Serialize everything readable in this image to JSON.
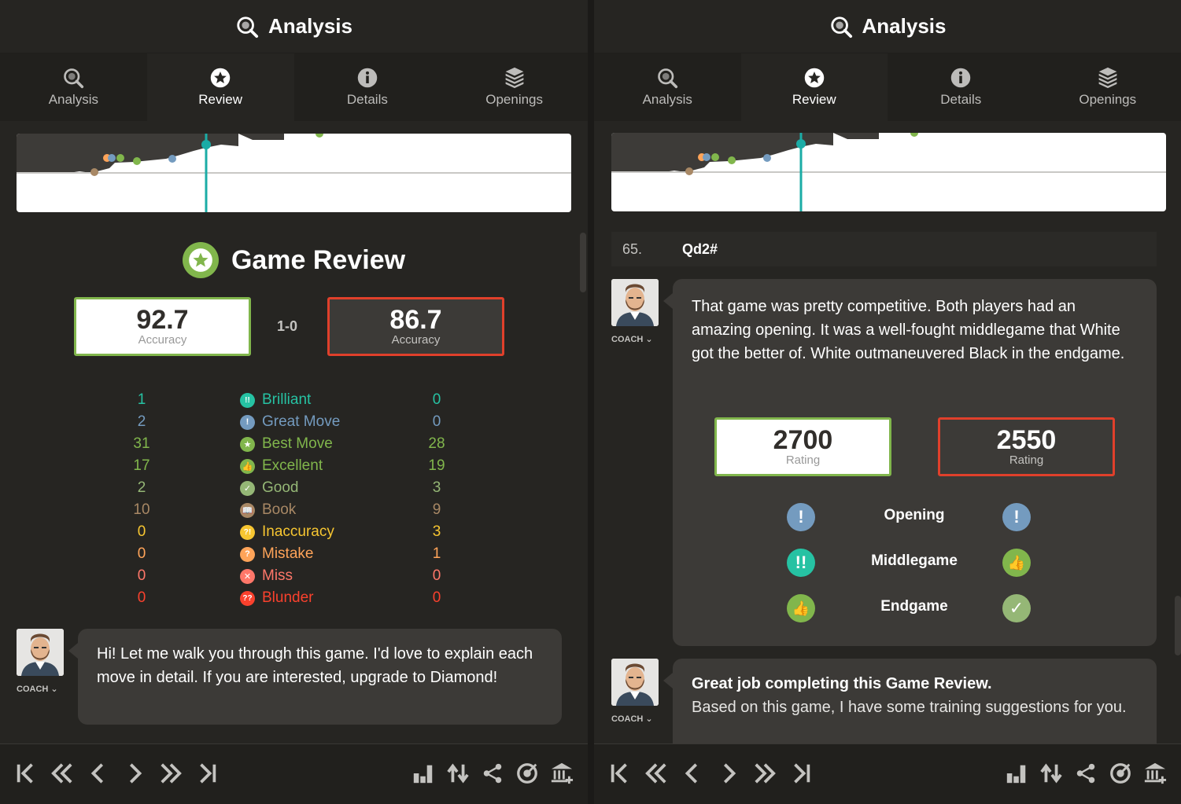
{
  "left": {
    "header_title": "Analysis",
    "tabs": [
      {
        "label": "Analysis",
        "icon": "magnifier-icon"
      },
      {
        "label": "Review",
        "icon": "star-icon"
      },
      {
        "label": "Details",
        "icon": "info-icon"
      },
      {
        "label": "Openings",
        "icon": "book-stack-icon"
      }
    ],
    "active_tab": "Review",
    "review_title": "Game Review",
    "white_accuracy": "92.7",
    "black_accuracy": "86.7",
    "accuracy_label": "Accuracy",
    "result": "1-0",
    "stats": [
      {
        "label": "Brilliant",
        "white": "1",
        "black": "0",
        "color": "#26c2a3",
        "icon": "!!"
      },
      {
        "label": "Great Move",
        "white": "2",
        "black": "0",
        "color": "#749bbf",
        "icon": "!"
      },
      {
        "label": "Best Move",
        "white": "31",
        "black": "28",
        "color": "#81b64c",
        "icon": "★"
      },
      {
        "label": "Excellent",
        "white": "17",
        "black": "19",
        "color": "#81b64c",
        "icon": "👍"
      },
      {
        "label": "Good",
        "white": "2",
        "black": "3",
        "color": "#95b776",
        "icon": "✓"
      },
      {
        "label": "Book",
        "white": "10",
        "black": "9",
        "color": "#a88865",
        "icon": "📖"
      },
      {
        "label": "Inaccuracy",
        "white": "0",
        "black": "3",
        "color": "#f7c631",
        "icon": "?!"
      },
      {
        "label": "Mistake",
        "white": "0",
        "black": "1",
        "color": "#ffa459",
        "icon": "?"
      },
      {
        "label": "Miss",
        "white": "0",
        "black": "0",
        "color": "#ff7769",
        "icon": "✕"
      },
      {
        "label": "Blunder",
        "white": "0",
        "black": "0",
        "color": "#fa412d",
        "icon": "??"
      }
    ],
    "coach_label": "COACH",
    "coach_message": "Hi! Let me walk you through this game. I'd love to explain each move in detail. If you are interested, upgrade to Diamond!"
  },
  "right": {
    "header_title": "Analysis",
    "tabs": [
      {
        "label": "Analysis"
      },
      {
        "label": "Review"
      },
      {
        "label": "Details"
      },
      {
        "label": "Openings"
      }
    ],
    "move_number": "65.",
    "move": "Qd2#",
    "coach_label": "COACH",
    "coach_message": "That game was pretty competitive. Both players had an amazing opening. It was a well-fought middlegame that White got the better of. White outmaneuvered Black in the endgame.",
    "white_rating": "2700",
    "black_rating": "2550",
    "rating_label": "Rating",
    "phases": [
      {
        "label": "Opening",
        "white_icon": "great-move-icon",
        "black_icon": "great-move-icon"
      },
      {
        "label": "Middlegame",
        "white_icon": "brilliant-icon",
        "black_icon": "excellent-icon"
      },
      {
        "label": "Endgame",
        "white_icon": "excellent-icon",
        "black_icon": "good-icon"
      }
    ],
    "coach2_label": "COACH",
    "coach2_title": "Great job completing this Game Review.",
    "coach2_message": "Based on this game, I have some training suggestions for you."
  },
  "colors": {
    "panel_bg": "#262522",
    "white_border": "#81b64c",
    "black_border": "#e0402b",
    "current_move_marker": "#1baca6"
  }
}
